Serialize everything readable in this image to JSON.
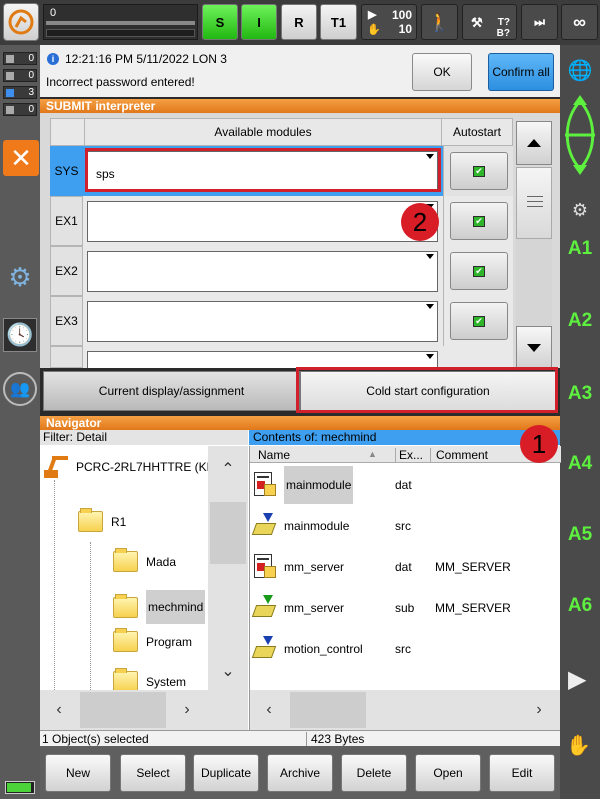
{
  "topbar": {
    "progress_value": "0",
    "btn_s": "S",
    "btn_i": "I",
    "btn_r": "R",
    "btn_t1": "T1",
    "override_top": "100",
    "override_bottom": "10",
    "tq": "T?",
    "bq": "B?",
    "infinity": "∞"
  },
  "left_indicators": [
    "0",
    "0",
    "3",
    "0"
  ],
  "message": {
    "timestamp": "12:21:16 PM 5/11/2022 LON 3",
    "text": "Incorrect password entered!",
    "ok_label": "OK",
    "confirm_all_label": "Confirm all"
  },
  "submit": {
    "title": "SUBMIT interpreter",
    "col_modules": "Available modules",
    "col_autostart": "Autostart",
    "rows": [
      {
        "label": "SYS",
        "value": "sps"
      },
      {
        "label": "EX1",
        "value": ""
      },
      {
        "label": "EX2",
        "value": ""
      },
      {
        "label": "EX3",
        "value": ""
      }
    ],
    "tab_current": "Current display/assignment",
    "tab_cold": "Cold start configuration"
  },
  "navigator": {
    "title": "Navigator",
    "filter": "Filter: Detail",
    "contents": "Contents of: mechmind",
    "tree": {
      "root": "PCRC-2RL7HHTTRE (KR",
      "r1": "R1",
      "mada": "Mada",
      "mechmind": "mechmind",
      "program": "Program",
      "system": "System"
    },
    "cols": {
      "name": "Name",
      "ext": "Ex...",
      "comment": "Comment"
    },
    "files": [
      {
        "name": "mainmodule",
        "ext": "dat",
        "comment": ""
      },
      {
        "name": "mainmodule",
        "ext": "src",
        "comment": ""
      },
      {
        "name": "mm_server",
        "ext": "dat",
        "comment": "MM_SERVER"
      },
      {
        "name": "mm_server",
        "ext": "sub",
        "comment": "MM_SERVER"
      },
      {
        "name": "motion_control",
        "ext": "src",
        "comment": ""
      }
    ],
    "status_selected": "1 Object(s) selected",
    "status_bytes": "423 Bytes"
  },
  "bottom_buttons": [
    "New",
    "Select",
    "Duplicate",
    "Archive",
    "Delete",
    "Open",
    "Edit"
  ],
  "right_labels": [
    "A1",
    "A2",
    "A3",
    "A4",
    "A5",
    "A6"
  ],
  "badges": [
    "1",
    "2"
  ],
  "colors": {
    "accent_orange": "#e0781a",
    "highlight_red": "#d0202b",
    "axis_green": "#5ef03f",
    "selection_blue": "#3e9ff0"
  }
}
